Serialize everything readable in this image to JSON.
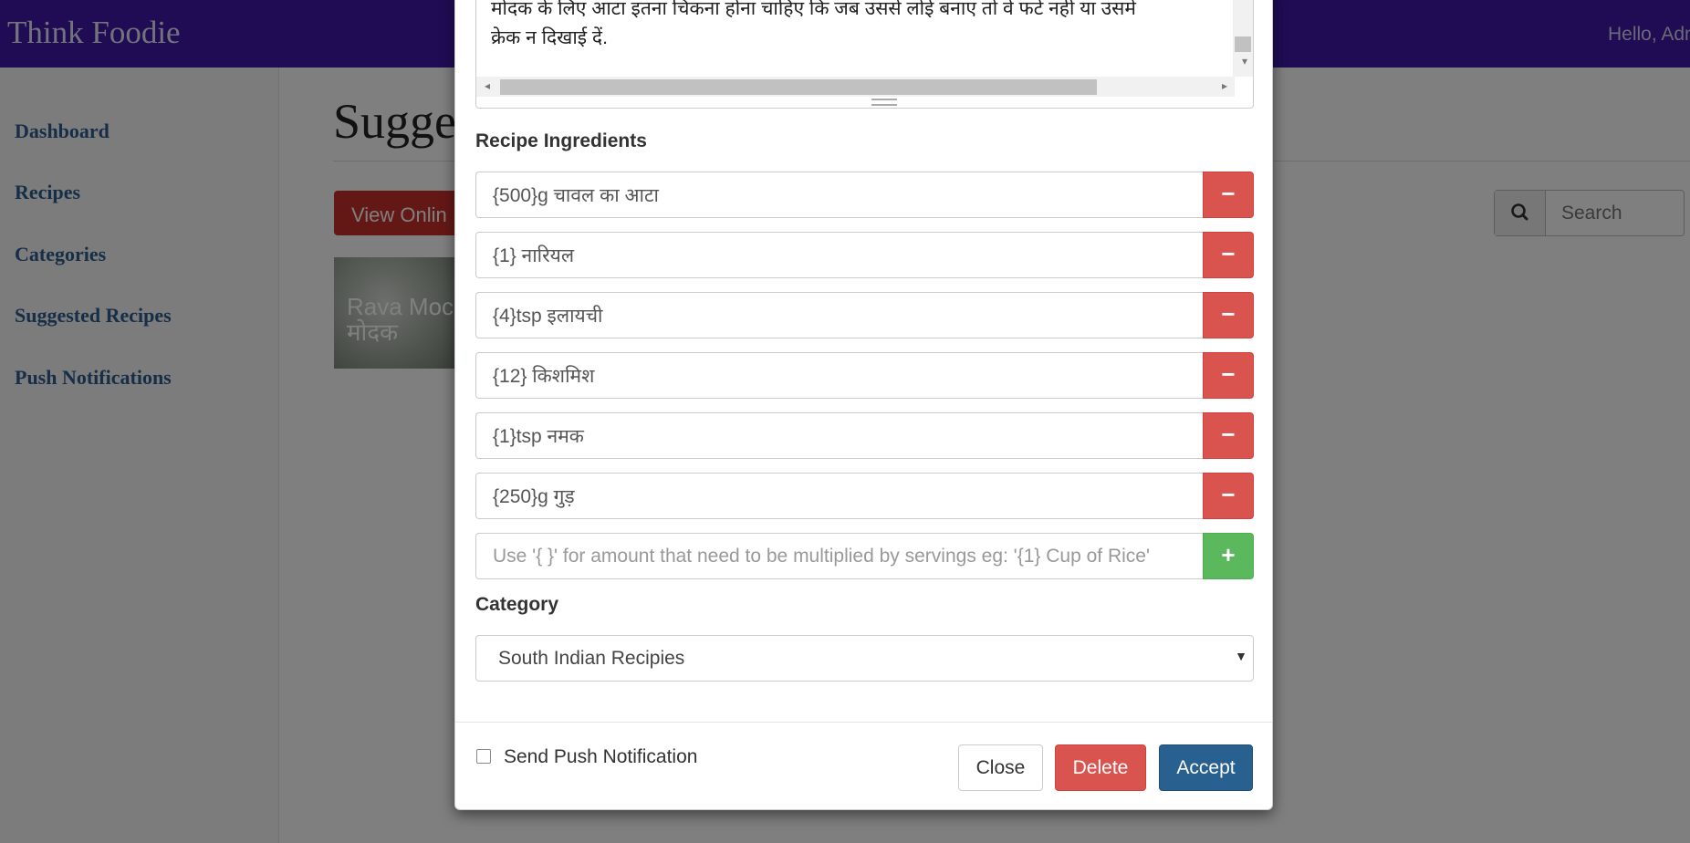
{
  "app": {
    "brand": "Think Foodie",
    "greeting": "Hello, Admi"
  },
  "sidebar": {
    "items": [
      {
        "label": "Dashboard"
      },
      {
        "label": "Recipes"
      },
      {
        "label": "Categories"
      },
      {
        "label": "Suggested Recipes"
      },
      {
        "label": "Push Notifications"
      }
    ]
  },
  "main": {
    "title": "Sugge",
    "view_button": "View Onlin",
    "search_placeholder": "Search",
    "recipe_card": {
      "line1": "Rava Moc",
      "line2": "मोदक"
    }
  },
  "modal": {
    "description_lines": [
      "मोदक के लिए आटा इतना चिकना होना चाहिए कि जब उससे लोई बनाए तो वे फटे नहीं या उसमे",
      "क्रेक न दिखाई दें."
    ],
    "ingredients_label": "Recipe Ingredients",
    "ingredients": [
      "{500}g चावल का आटा",
      "{1} नारियल",
      "{4}tsp इलायची",
      "{12} किशमिश",
      "{1}tsp नमक",
      "{250}g गुड़"
    ],
    "new_ingredient_placeholder": "Use '{ }' for amount that need to be multiplied by servings eg: '{1} Cup of Rice'",
    "remove_symbol": "−",
    "add_symbol": "+",
    "category_label": "Category",
    "category_value": "South Indian Recipies",
    "send_push_label": "Send Push Notification",
    "buttons": {
      "close": "Close",
      "delete": "Delete",
      "accept": "Accept"
    }
  },
  "colors": {
    "topbar": "#3e18a8",
    "danger": "#d9534f",
    "success": "#5cb85c",
    "primary": "#286090",
    "nav_link": "#2c5c8e"
  },
  "icons": {
    "search": "search-icon",
    "remove": "minus-icon",
    "add": "plus-icon",
    "caret": "caret-down-icon"
  }
}
